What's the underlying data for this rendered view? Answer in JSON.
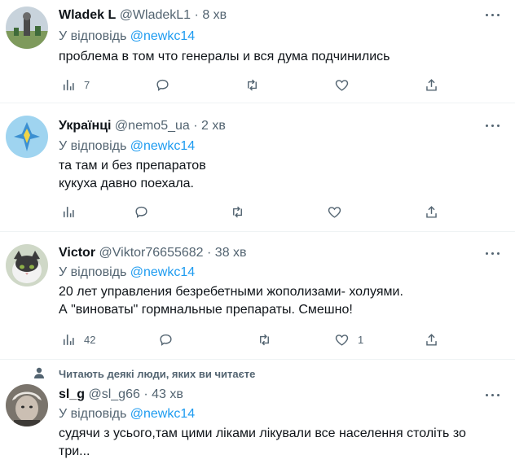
{
  "tweets": [
    {
      "name": "Wladek L",
      "handle": "@WladekL1",
      "dot": "·",
      "time": "8 хв",
      "reply_prefix": "У відповідь",
      "reply_to": "@newkc14",
      "text": "проблема в том что генералы  и вся дума подчинились",
      "analytics_count": "7",
      "like_count": ""
    },
    {
      "name": "Українці",
      "handle": "@nemo5_ua",
      "dot": "·",
      "time": "2 хв",
      "reply_prefix": "У відповідь",
      "reply_to": "@newkc14",
      "text": "та там и без препаратов\nкукуха давно поехала.",
      "analytics_count": "",
      "like_count": ""
    },
    {
      "name": "Victor",
      "handle": "@Viktor76655682",
      "dot": "·",
      "time": "38 хв",
      "reply_prefix": "У відповідь",
      "reply_to": "@newkc14",
      "text": "20 лет управления безребетными жополизами- холуями.\nА \"виноваты\" гормнальные препараты. Смешно!",
      "analytics_count": "42",
      "like_count": "1"
    },
    {
      "social_context": "Читають деякі люди, яких ви читаєте",
      "name": "sl_g",
      "handle": "@sl_g66",
      "dot": "·",
      "time": "43 хв",
      "reply_prefix": "У відповідь",
      "reply_to": "@newkc14",
      "text": "судячи з усього,там цими ліками лікували все населення століть зо\nтри..."
    }
  ],
  "colors": {
    "accent": "#1d9bf0",
    "secondary": "#536471",
    "text": "#0f1419",
    "divider": "#eff3f4"
  },
  "icons": [
    "more-icon",
    "analytics-icon",
    "reply-icon",
    "retweet-icon",
    "like-icon",
    "share-icon",
    "person-icon"
  ]
}
